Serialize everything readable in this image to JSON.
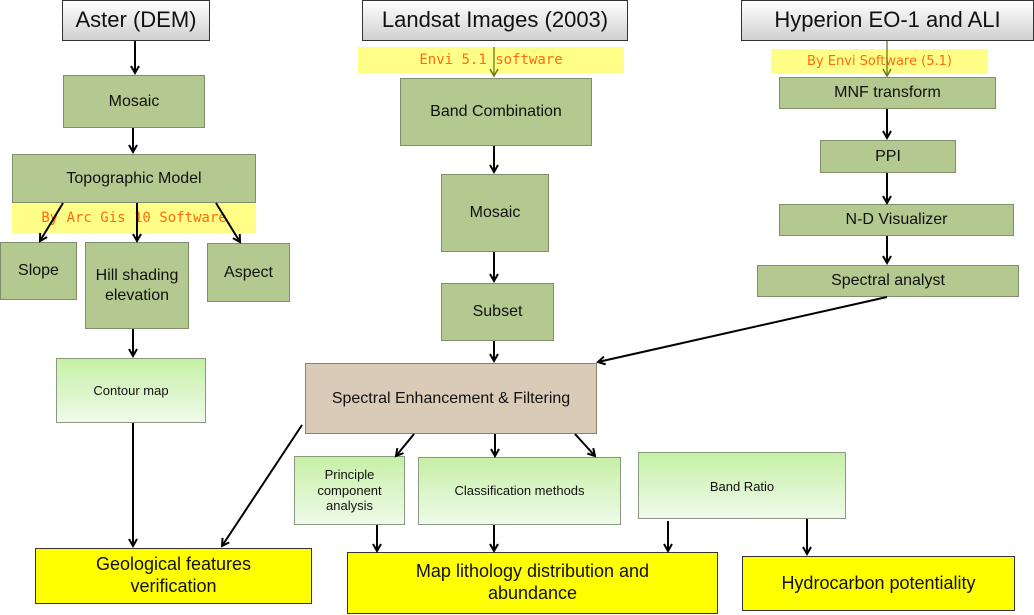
{
  "sources": {
    "aster": "Aster (DEM)",
    "landsat": "Landsat Images (2003)",
    "hyperion": "Hyperion EO-1 and ALI"
  },
  "software": {
    "landsat": "Envi 5.1 software",
    "hyperion": "By Envi Software (5.1)",
    "aster": "By Arc Gis 10 Software"
  },
  "aster_steps": {
    "mosaic": "Mosaic",
    "topographic": "Topographic Model",
    "slope": "Slope",
    "hill": "Hill shading elevation",
    "aspect": "Aspect",
    "contour": "Contour map"
  },
  "landsat_steps": {
    "band_combination": "Band Combination",
    "mosaic": "Mosaic",
    "subset": "Subset"
  },
  "hyperion_steps": {
    "mnf": "MNF transform",
    "ppi": "PPI",
    "nd": "N-D Visualizer",
    "spectral": "Spectral analyst"
  },
  "processing": {
    "enhancement": "Spectral Enhancement & Filtering",
    "pca": "Principle component analysis",
    "classification": "Classification methods",
    "band_ratio": "Band Ratio"
  },
  "outputs": {
    "geological": "Geological features verification",
    "lithology": "Map lithology distribution and abundance",
    "hydrocarbon": "Hydrocarbon potentiality"
  },
  "colors": {
    "process_green": "#b3c98f",
    "enhancement": "#d9cbb8",
    "output_yellow": "#ffff00",
    "software_text": "#ff6a10",
    "highlight": "#ffff88"
  }
}
